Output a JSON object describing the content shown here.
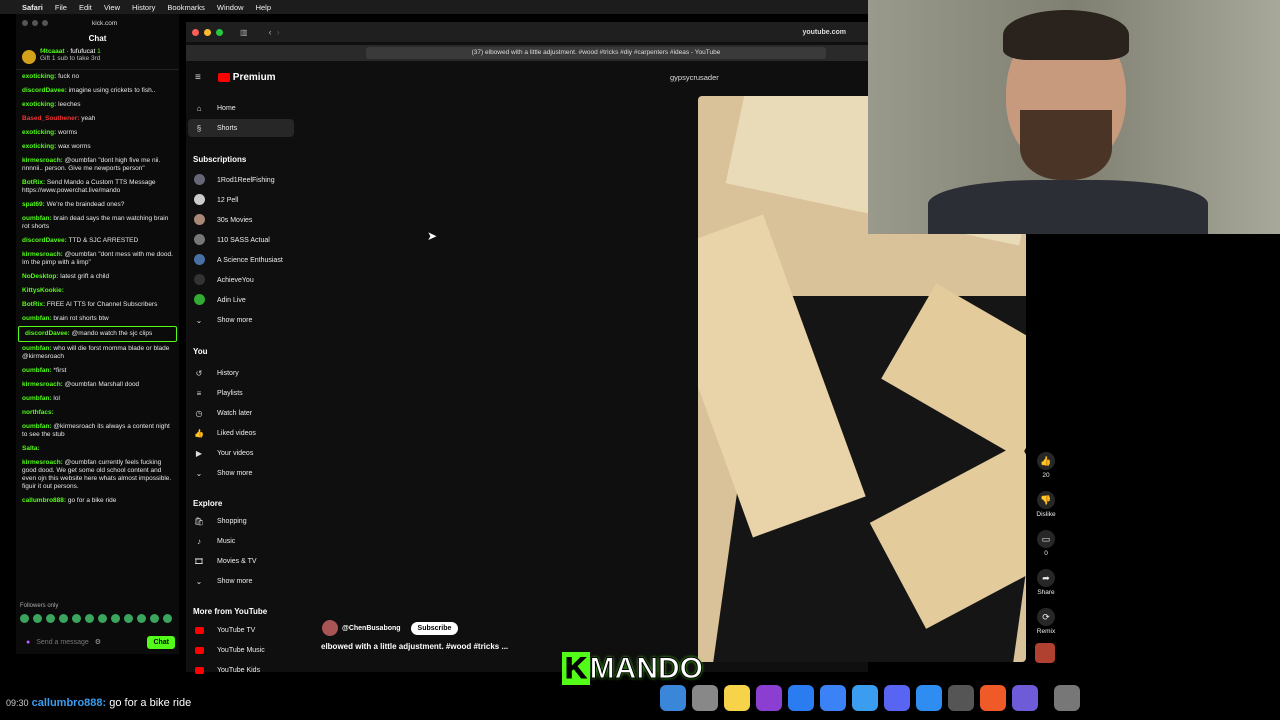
{
  "menubar": {
    "app": "Safari",
    "items": [
      "File",
      "Edit",
      "View",
      "History",
      "Bookmarks",
      "Window",
      "Help"
    ]
  },
  "chat": {
    "window_url": "kick.com",
    "title": "Chat",
    "gift": {
      "user1": "f4tcaaat",
      "user2": "fufufucat",
      "count": "1",
      "text": "Gift 1 sub to take 3rd"
    },
    "messages": [
      {
        "user": "exoticking:",
        "text": "fuck no",
        "color": "#53fc18"
      },
      {
        "user": "discordDavee:",
        "text": "imagine using crickets to fish..",
        "color": "#53fc18"
      },
      {
        "user": "exoticking:",
        "text": "leeches",
        "color": "#53fc18"
      },
      {
        "user": "Based_Southener:",
        "text": "yeah",
        "color": "#e33"
      },
      {
        "user": "exoticking:",
        "text": "worms",
        "color": "#53fc18"
      },
      {
        "user": "exoticking:",
        "text": "wax worms",
        "color": "#53fc18"
      },
      {
        "user": "kirmesroach:",
        "text": "@oumbfan \"dont high five me nii. nnnnii.. person. Give me newports person\"",
        "color": "#53fc18"
      },
      {
        "user": "BotRix:",
        "text": "Send Mando a Custom TTS Message https://www.powerchat.live/mando",
        "color": "#53fc18"
      },
      {
        "user": "spat69:",
        "text": "We're the braindead ones?",
        "color": "#53fc18"
      },
      {
        "user": "oumbfan:",
        "text": "brain dead says the man watching brain rot shorts",
        "color": "#53fc18"
      },
      {
        "user": "discordDavee:",
        "text": "TTD & SJC ARRESTED",
        "color": "#53fc18"
      },
      {
        "user": "kirmesroach:",
        "text": "@oumbfan \"dont mess with me dood. Im the pimp with a limp\"",
        "color": "#53fc18"
      },
      {
        "user": "NoDesktop:",
        "text": "latest grift a child",
        "color": "#53fc18"
      },
      {
        "user": "KittysKookie:",
        "text": "",
        "color": "#53fc18"
      },
      {
        "user": "BotRix:",
        "text": "FREE AI TTS for Channel Subscribers",
        "color": "#53fc18"
      },
      {
        "user": "oumbfan:",
        "text": "brain rot shorts btw",
        "color": "#53fc18"
      },
      {
        "user": "discordDavee:",
        "text": "@mando watch the sjc clips",
        "color": "#53fc18"
      },
      {
        "user": "oumbfan:",
        "text": "who will die forst momma blade or blade @kirmesroach",
        "color": "#53fc18"
      },
      {
        "user": "oumbfan:",
        "text": "*first",
        "color": "#53fc18"
      },
      {
        "user": "kirmesroach:",
        "text": "@oumbfan Marshall dood",
        "color": "#53fc18"
      },
      {
        "user": "oumbfan:",
        "text": "lol",
        "color": "#53fc18"
      },
      {
        "user": "northfacs:",
        "text": "",
        "color": "#53fc18"
      },
      {
        "user": "oumbfan:",
        "text": "@kirmesroach its always a content night to see the stub",
        "color": "#53fc18"
      },
      {
        "user": "Salta:",
        "text": "",
        "color": "#53fc18"
      },
      {
        "user": "kirmesroach:",
        "text": "@oumbfan currently feels fucking good dood. We get some old school content and even ojn this website here whats almost impossible. figuir it out persons.",
        "color": "#53fc18"
      },
      {
        "user": "callumbro888:",
        "text": "go for a bike ride",
        "color": "#53fc18"
      }
    ],
    "followers_only": "Followers only",
    "input_placeholder": "Send a message",
    "chat_button": "Chat"
  },
  "browser": {
    "url": "youtube.com",
    "tab_title": "(37) elbowed with a little adjustment. #wood #tricks #diy #carpenters #ideas - YouTube"
  },
  "youtube": {
    "logo": "Premium",
    "channel_handle": "gypsycrusader",
    "nav": [
      {
        "label": "Home",
        "icon": "⌂"
      },
      {
        "label": "Shorts",
        "icon": "§"
      }
    ],
    "subs_heading": "Subscriptions",
    "subscriptions": [
      "1Rod1ReelFishing",
      "12 Pell",
      "30s Movies",
      "110 SASS Actual",
      "A Science Enthusiast",
      "AchieveYou",
      "Adin Live"
    ],
    "show_more": "Show more",
    "you_heading": "You",
    "you_items": [
      {
        "label": "History",
        "icon": "↺"
      },
      {
        "label": "Playlists",
        "icon": "≡"
      },
      {
        "label": "Watch later",
        "icon": "◷"
      },
      {
        "label": "Liked videos",
        "icon": "👍"
      },
      {
        "label": "Your videos",
        "icon": "▶"
      }
    ],
    "explore_heading": "Explore",
    "explore_items": [
      {
        "label": "Shopping",
        "icon": "🛍"
      },
      {
        "label": "Music",
        "icon": "♪"
      },
      {
        "label": "Movies & TV",
        "icon": "🎞"
      }
    ],
    "more_heading": "More from YouTube",
    "more_items": [
      "YouTube TV",
      "YouTube Music",
      "YouTube Kids"
    ],
    "short": {
      "channel": "@ChenBusabong",
      "subscribe": "Subscribe",
      "title": "elbowed with a little adjustment. #wood #tricks ...",
      "likes": "20",
      "dislike": "Dislike",
      "comments": "0",
      "share": "Share",
      "remix": "Remix"
    }
  },
  "overlay": {
    "brand": "MANDO",
    "ticker_time": "09:30",
    "ticker_user": "callumbro888:",
    "ticker_text": "go for a bike ride"
  }
}
